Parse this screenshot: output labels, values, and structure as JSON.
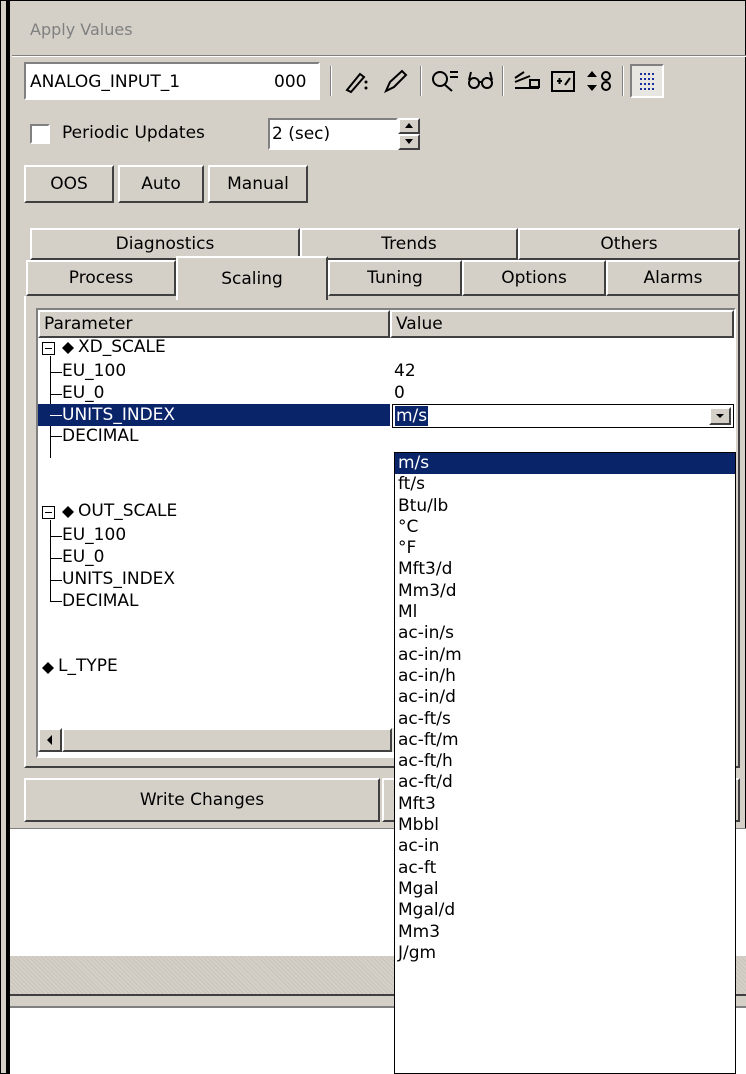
{
  "panel_title": "Apply Values",
  "device": {
    "name": "ANALOG_INPUT_1",
    "index": "000"
  },
  "periodic": {
    "label": "Periodic Updates",
    "checked": false,
    "interval": "2 (sec)"
  },
  "mode_buttons": [
    "OOS",
    "Auto",
    "Manual"
  ],
  "tabs_row1": [
    "Diagnostics",
    "Trends",
    "Others"
  ],
  "tabs_row2": [
    "Process",
    "Scaling",
    "Tuning",
    "Options",
    "Alarms"
  ],
  "active_tab": "Scaling",
  "grid": {
    "headers": [
      "Parameter",
      "Value"
    ],
    "xd_scale": {
      "label": "XD_SCALE",
      "eu_100": "EU_100",
      "eu_100_value": "42",
      "eu_0": "EU_0",
      "eu_0_value": "0",
      "units_index": "UNITS_INDEX",
      "units_value": "m/s",
      "decimal": "DECIMAL"
    },
    "out_scale": {
      "label": "OUT_SCALE",
      "eu_100": "EU_100",
      "eu_0": "EU_0",
      "units_index": "UNITS_INDEX",
      "decimal": "DECIMAL"
    },
    "l_type": "L_TYPE"
  },
  "write_button": "Write Changes",
  "dropdown_options": [
    "m/s",
    "ft/s",
    "Btu/lb",
    "°C",
    "°F",
    "Mft3/d",
    "Mm3/d",
    "Ml",
    "ac-in/s",
    "ac-in/m",
    "ac-in/h",
    "ac-in/d",
    "ac-ft/s",
    "ac-ft/m",
    "ac-ft/h",
    "ac-ft/d",
    "Mft3",
    "Mbbl",
    "ac-in",
    "ac-ft",
    "Mgal",
    "Mgal/d",
    "Mm3",
    "J/gm"
  ],
  "selected_option": "m/s",
  "colors": {
    "selection": "#0a246a",
    "face": "#d4d0c8",
    "window": "#ffffff"
  }
}
